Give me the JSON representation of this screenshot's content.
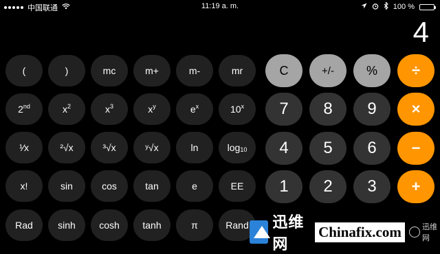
{
  "status": {
    "carrier": "中国联通",
    "time": "11:19 a. m.",
    "battery": "100 %",
    "battery_level": 1.0
  },
  "display": {
    "value": "4"
  },
  "keys": {
    "row1": [
      "(",
      ")",
      "mc",
      "m+",
      "m-",
      "mr",
      "C",
      "+/-",
      "%",
      "÷"
    ],
    "row2": {
      "second": [
        "2",
        "nd"
      ],
      "x2": [
        "x",
        "2"
      ],
      "x3": [
        "x",
        "3"
      ],
      "xy": [
        "x",
        "y"
      ],
      "ex": [
        "e",
        "x"
      ],
      "tenx": [
        "10",
        "x"
      ],
      "digits": [
        "7",
        "8",
        "9"
      ],
      "op": "×"
    },
    "row3": {
      "recip": "¹⁄x",
      "sqrt2": "²√x",
      "sqrt3": "³√x",
      "sqrty": "ʸ√x",
      "ln": "ln",
      "log10": [
        "log",
        "10"
      ],
      "digits": [
        "4",
        "5",
        "6"
      ],
      "op": "−"
    },
    "row4": [
      "x!",
      "sin",
      "cos",
      "tan",
      "e",
      "EE",
      "1",
      "2",
      "3",
      "+"
    ],
    "row5": [
      "Rad",
      "sinh",
      "cosh",
      "tanh",
      "π",
      "Rand"
    ]
  },
  "watermark": {
    "cn": "迅维网",
    "en": "Chinafix.com",
    "wechat": "迅维网"
  },
  "colors": {
    "background": "#000000",
    "sci_key": "#212121",
    "digit_key": "#333333",
    "function_key": "#a5a5a5",
    "operator_key": "#ff9500"
  }
}
